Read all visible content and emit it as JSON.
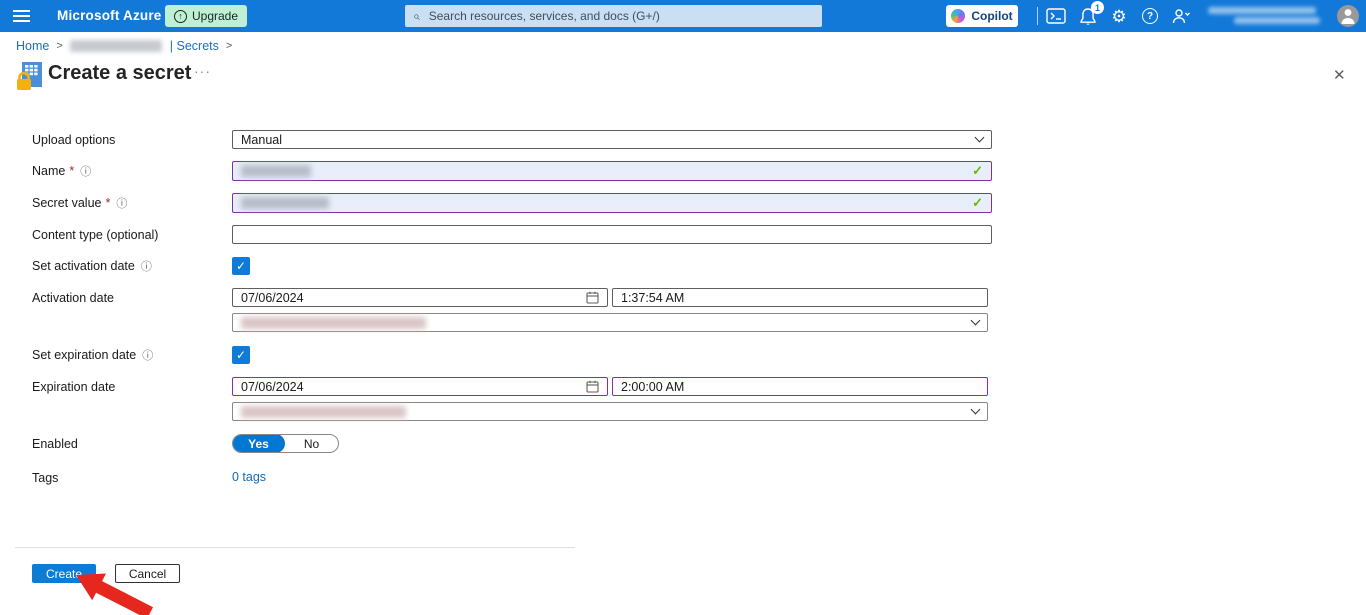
{
  "topbar": {
    "brand": "Microsoft Azure",
    "upgrade_label": "Upgrade",
    "search_placeholder": "Search resources, services, and docs (G+/)",
    "copilot_label": "Copilot",
    "notification_count": "1"
  },
  "breadcrumb": {
    "home": "Home",
    "sep1": ">",
    "secrets_part": "| Secrets",
    "sep2": ">"
  },
  "page": {
    "title": "Create a secret",
    "more_glyph": "···",
    "close_glyph": "✕"
  },
  "form": {
    "required_mark": "*",
    "info_glyph": "ⓘ",
    "check_glyph": "✓",
    "upload_options_label": "Upload options",
    "upload_options_value": "Manual",
    "name_label": "Name",
    "secret_value_label": "Secret value",
    "content_type_label": "Content type (optional)",
    "set_activation_label": "Set activation date",
    "activation_label": "Activation date",
    "activation_date": "07/06/2024",
    "activation_time": "1:37:54 AM",
    "set_expiration_label": "Set expiration date",
    "expiration_label": "Expiration date",
    "expiration_date": "07/06/2024",
    "expiration_time": "2:00:00 AM",
    "enabled_label": "Enabled",
    "enabled_yes": "Yes",
    "enabled_no": "No",
    "tags_label": "Tags",
    "tags_link": "0 tags"
  },
  "footer": {
    "create_label": "Create",
    "cancel_label": "Cancel"
  },
  "colors": {
    "topbar_blue": "#1279d8",
    "accent": "#0078d4",
    "valid_border": "#8a2da5",
    "valid_bg": "#e8eefb",
    "success_check": "#6bb700",
    "link": "#0f6cbd",
    "upgrade_bg": "#bff0d5",
    "annotation_red": "#e5271d"
  }
}
